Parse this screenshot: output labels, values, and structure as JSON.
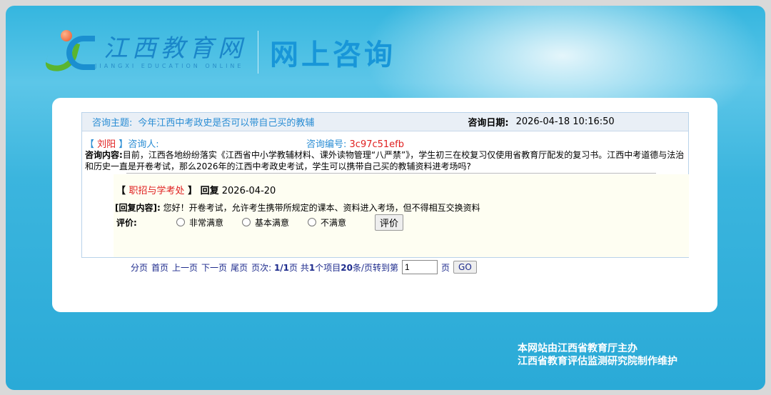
{
  "header": {
    "brand_cn": "江西教育网",
    "brand_en": "JIANGXI EDUCATION ONLINE",
    "page_title": "网上咨询"
  },
  "consult": {
    "topic_label": "咨询主题:",
    "topic": "今年江西中考政史是否可以带自己买的教辅",
    "date_label": "咨询日期:",
    "date": "2026-04-18 10:16:50",
    "asker_name": "刘阳",
    "asker_label": "咨询人:",
    "id_label": "咨询编号:",
    "id": "3c97c51efb",
    "content_label": "咨询内容:",
    "content": "目前，江西各地纷纷落实《江西省中小学教辅材料、课外读物管理“八严禁”》，学生初三在校复习仅使用省教育厅配发的复习书。江西中考道德与法治和历史一直是开卷考试，那么2026年的江西中考政史考试，学生可以携带自己买的教辅资料进考场吗?"
  },
  "reply": {
    "dept": "职招与学考处",
    "reply_label": "回复",
    "date": "2026-04-20",
    "content_label": "[回复内容]:",
    "content": "您好！开卷考试，允许考生携带所规定的课本、资料进入考场，但不得相互交换资料",
    "rating_label": "评价:",
    "options": [
      "非常满意",
      "基本满意",
      "不满意"
    ],
    "submit": "评价"
  },
  "pager": {
    "items": [
      "分页",
      "首页",
      "上一页",
      "下一页",
      "尾页"
    ],
    "page_label": "页次:",
    "page": "1/1",
    "page_unit": "页",
    "total_prefix": "共",
    "total": "1",
    "total_suffix": "个项目",
    "per_page": "20",
    "per_page_suffix": "条/页转到第",
    "jump_value": "1",
    "jump_unit": "页",
    "go": "GO"
  },
  "footer": {
    "line1": "本网站由江西省教育厅主办",
    "line2": "江西省教育评估监测研究院制作维护"
  }
}
